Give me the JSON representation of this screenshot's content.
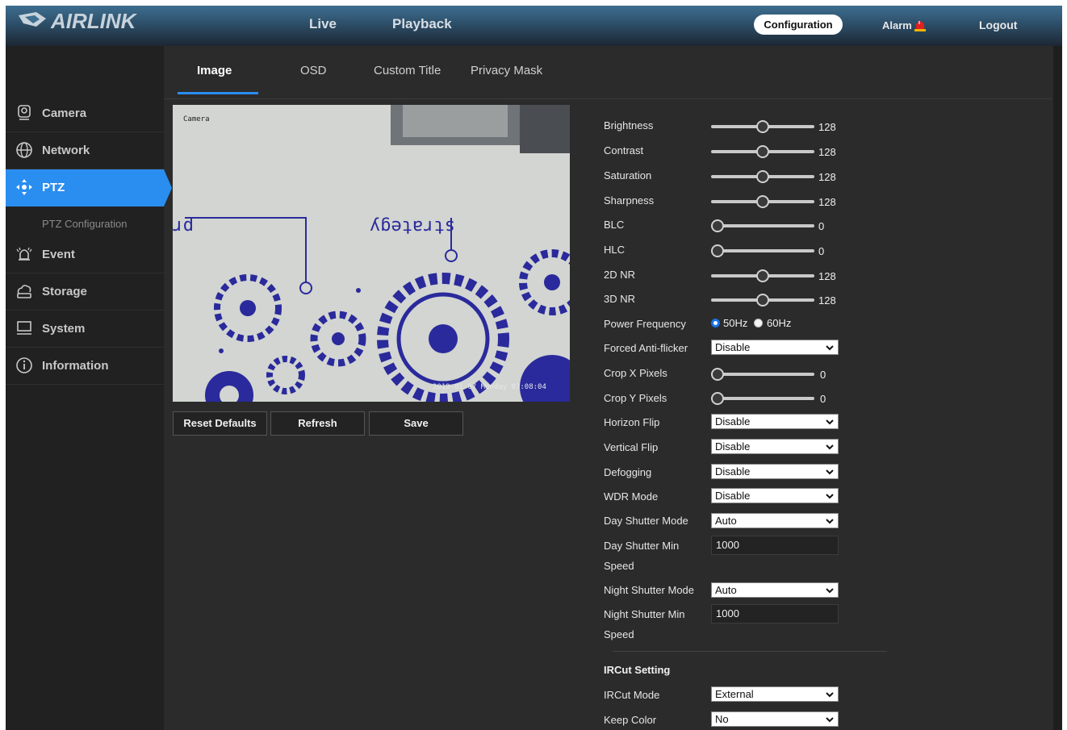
{
  "brand": "AIRLINK",
  "nav": {
    "live": "Live",
    "playback": "Playback",
    "configuration": "Configuration",
    "alarm": "Alarm",
    "logout": "Logout"
  },
  "sidebar": {
    "items": [
      {
        "label": "Camera",
        "icon": "camera-icon"
      },
      {
        "label": "Network",
        "icon": "globe-icon"
      },
      {
        "label": "PTZ",
        "icon": "ptz-arrows-icon",
        "active": true
      },
      {
        "label": "Event",
        "icon": "alarm-bell-icon"
      },
      {
        "label": "Storage",
        "icon": "storage-icon"
      },
      {
        "label": "System",
        "icon": "monitor-icon"
      },
      {
        "label": "Information",
        "icon": "info-icon"
      }
    ],
    "sub_item": "PTZ Configuration"
  },
  "tabs": [
    {
      "label": "Image",
      "active": true
    },
    {
      "label": "OSD"
    },
    {
      "label": "Custom Title"
    },
    {
      "label": "Privacy Mask"
    }
  ],
  "preview": {
    "osd_name": "Camera",
    "osd_time": "2019-01-07 Monday 07:08:04",
    "wall_text_1": "progress",
    "wall_text_2": "strategy"
  },
  "buttons": {
    "reset": "Reset Defaults",
    "refresh": "Refresh",
    "save": "Save"
  },
  "sliders": [
    {
      "label": "Brightness",
      "value": 128,
      "max": 255
    },
    {
      "label": "Contrast",
      "value": 128,
      "max": 255
    },
    {
      "label": "Saturation",
      "value": 128,
      "max": 255
    },
    {
      "label": "Sharpness",
      "value": 128,
      "max": 255
    },
    {
      "label": "BLC",
      "value": 0,
      "max": 255
    },
    {
      "label": "HLC",
      "value": 0,
      "max": 255
    },
    {
      "label": "2D NR",
      "value": 128,
      "max": 255
    },
    {
      "label": "3D NR",
      "value": 128,
      "max": 255
    }
  ],
  "power_frequency": {
    "label": "Power Frequency",
    "options": [
      "50Hz",
      "60Hz"
    ],
    "selected": "50Hz"
  },
  "anti_flicker": {
    "label": "Forced Anti-flicker",
    "value": "Disable"
  },
  "crop": [
    {
      "label": "Crop X Pixels",
      "value": 0,
      "max": 255
    },
    {
      "label": "Crop Y Pixels",
      "value": 0,
      "max": 255
    }
  ],
  "selects": [
    {
      "label": "Horizon Flip",
      "value": "Disable"
    },
    {
      "label": "Vertical Flip",
      "value": "Disable"
    },
    {
      "label": "Defogging",
      "value": "Disable"
    },
    {
      "label": "WDR Mode",
      "value": "Disable"
    },
    {
      "label": "Day Shutter Mode",
      "value": "Auto"
    }
  ],
  "day_shutter_min": {
    "label_1": "Day Shutter Min",
    "label_2": "Speed",
    "value": "1000"
  },
  "night_shutter_mode": {
    "label": "Night Shutter Mode",
    "value": "Auto"
  },
  "night_shutter_min": {
    "label_1": "Night Shutter Min",
    "label_2": "Speed",
    "value": "1000"
  },
  "ircut": {
    "title": "IRCut Setting",
    "mode_label": "IRCut Mode",
    "mode_value": "External",
    "keep_color_label": "Keep Color",
    "keep_color_value": "No"
  },
  "colors": {
    "accent": "#2a8df0",
    "background": "#2b2b2b",
    "sidebar": "#212121"
  }
}
